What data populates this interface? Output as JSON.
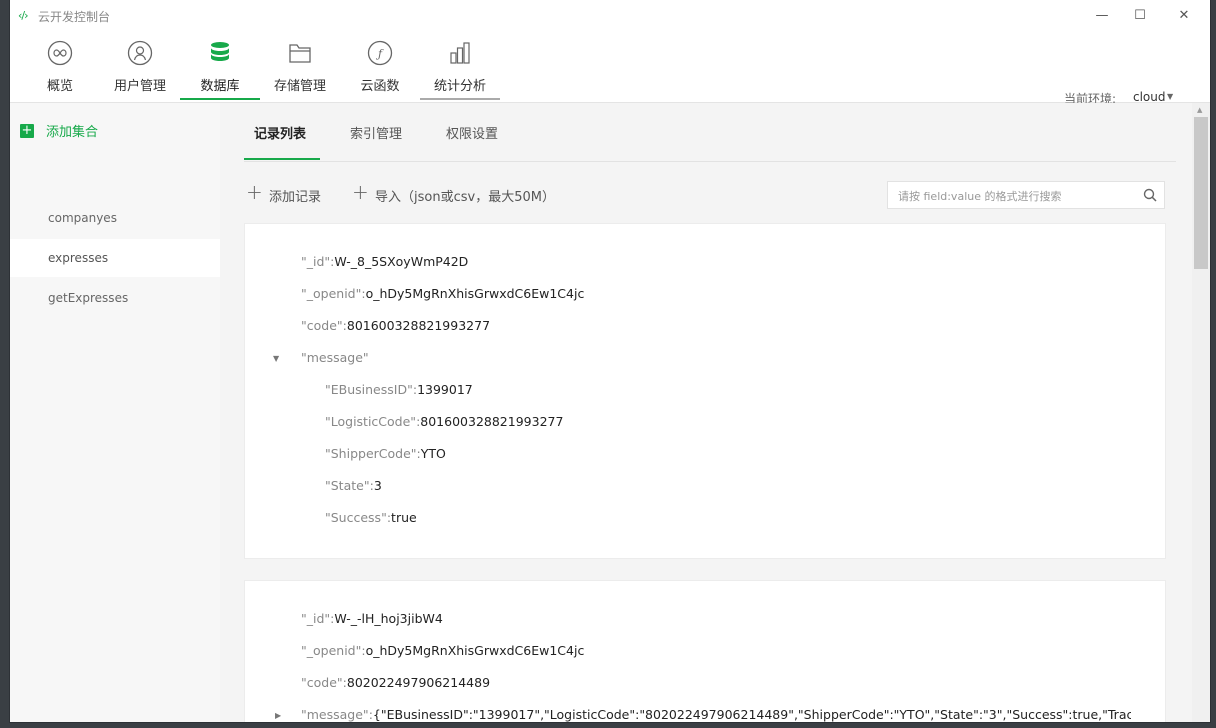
{
  "window": {
    "title": "云开发控制台",
    "controls": {
      "minimize": "—",
      "maximize": "☐",
      "close": "✕"
    }
  },
  "toolbar": {
    "items": [
      {
        "label": "概览",
        "icon": "infinity-icon"
      },
      {
        "label": "用户管理",
        "icon": "user-icon"
      },
      {
        "label": "数据库",
        "icon": "database-icon"
      },
      {
        "label": "存储管理",
        "icon": "folder-icon"
      },
      {
        "label": "云函数",
        "icon": "function-icon"
      },
      {
        "label": "统计分析",
        "icon": "bar-chart-icon"
      }
    ],
    "active": "数据库",
    "env_label": "当前环境:",
    "env_value": "cloud"
  },
  "sidebar": {
    "add_label": "添加集合",
    "collections": [
      "companyes",
      "expresses",
      "getExpresses"
    ],
    "active": "expresses"
  },
  "tabs": [
    "记录列表",
    "索引管理",
    "权限设置"
  ],
  "actions": {
    "add_record": "添加记录",
    "import": "导入（json或csv，最大50M）"
  },
  "search": {
    "placeholder": "请按 field:value 的格式进行搜索"
  },
  "records": [
    {
      "id_key": "\"_id\"",
      "id_val": "W-_8_5SXoyWmP42D",
      "openid_key": "\"_openid\"",
      "openid_val": "o_hDy5MgRnXhisGrwxdC6Ew1C4jc",
      "code_key": "\"code\"",
      "code_val": "801600328821993277",
      "message_key": "\"message\"",
      "message_fields": [
        {
          "k": "\"EBusinessID\"",
          "v": "1399017"
        },
        {
          "k": "\"LogisticCode\"",
          "v": "801600328821993277"
        },
        {
          "k": "\"ShipperCode\"",
          "v": "YTO"
        },
        {
          "k": "\"State\"",
          "v": "3"
        },
        {
          "k": "\"Success\"",
          "v": "true"
        }
      ]
    },
    {
      "id_key": "\"_id\"",
      "id_val": "W-_-lH_hoj3jibW4",
      "openid_key": "\"_openid\"",
      "openid_val": "o_hDy5MgRnXhisGrwxdC6Ew1C4jc",
      "code_key": "\"code\"",
      "code_val": "802022497906214489",
      "message_key": "\"message\"",
      "message_inline": "{\"EBusinessID\":\"1399017\",\"LogisticCode\":\"802022497906214489\",\"ShipperCode\":\"YTO\",\"State\":\"3\",\"Success\":true,\"Trac…"
    }
  ]
}
